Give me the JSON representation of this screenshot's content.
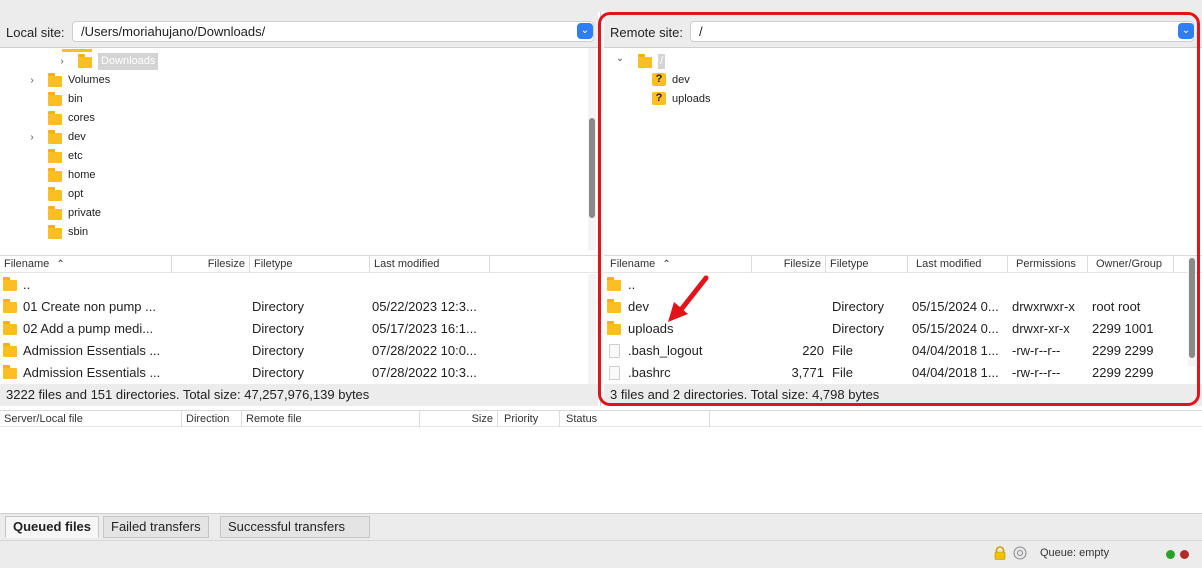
{
  "local": {
    "site_label": "Local site:",
    "site_path": "/Users/moriahujano/Downloads/",
    "tree": [
      {
        "label": "Downloads",
        "chevron": "›",
        "selected": true
      },
      {
        "label": "Volumes",
        "chevron": "›"
      },
      {
        "label": "bin",
        "chevron": ""
      },
      {
        "label": "cores",
        "chevron": ""
      },
      {
        "label": "dev",
        "chevron": "›"
      },
      {
        "label": "etc",
        "chevron": ""
      },
      {
        "label": "home",
        "chevron": ""
      },
      {
        "label": "opt",
        "chevron": ""
      },
      {
        "label": "private",
        "chevron": ""
      },
      {
        "label": "sbin",
        "chevron": ""
      }
    ],
    "columns": {
      "filename": "Filename",
      "filesize": "Filesize",
      "filetype": "Filetype",
      "last_modified": "Last modified"
    },
    "files": [
      {
        "name": "..",
        "size": "",
        "type": "",
        "modified": ""
      },
      {
        "name": "01 Create  non pump ...",
        "size": "",
        "type": "Directory",
        "modified": "05/22/2023 12:3..."
      },
      {
        "name": "02 Add a pump medi...",
        "size": "",
        "type": "Directory",
        "modified": "05/17/2023 16:1..."
      },
      {
        "name": "Admission Essentials ...",
        "size": "",
        "type": "Directory",
        "modified": "07/28/2022 10:0..."
      },
      {
        "name": "Admission Essentials ...",
        "size": "",
        "type": "Directory",
        "modified": "07/28/2022 10:3..."
      }
    ],
    "status": "3222 files and 151 directories. Total size: 47,257,976,139 bytes"
  },
  "remote": {
    "site_label": "Remote site:",
    "site_path": "/",
    "tree": [
      {
        "label": "/",
        "chevron": "⌄",
        "type": "folder",
        "selected": true
      },
      {
        "label": "dev",
        "chevron": "",
        "type": "unknown"
      },
      {
        "label": "uploads",
        "chevron": "",
        "type": "unknown"
      }
    ],
    "columns": {
      "filename": "Filename",
      "filesize": "Filesize",
      "filetype": "Filetype",
      "last_modified": "Last modified",
      "permissions": "Permissions",
      "owner_group": "Owner/Group"
    },
    "files": [
      {
        "name": "..",
        "icon": "folder",
        "size": "",
        "type": "",
        "modified": "",
        "perms": "",
        "owner": ""
      },
      {
        "name": "dev",
        "icon": "folder",
        "size": "",
        "type": "Directory",
        "modified": "05/15/2024 0...",
        "perms": "drwxrwxr-x",
        "owner": "root root"
      },
      {
        "name": "uploads",
        "icon": "folder",
        "size": "",
        "type": "Directory",
        "modified": "05/15/2024 0...",
        "perms": "drwxr-xr-x",
        "owner": "2299 1001"
      },
      {
        "name": ".bash_logout",
        "icon": "file",
        "size": "220",
        "type": "File",
        "modified": "04/04/2018 1...",
        "perms": "-rw-r--r--",
        "owner": "2299 2299"
      },
      {
        "name": ".bashrc",
        "icon": "file",
        "size": "3,771",
        "type": "File",
        "modified": "04/04/2018 1...",
        "perms": "-rw-r--r--",
        "owner": "2299 2299"
      }
    ],
    "status": "3 files and 2 directories. Total size: 4,798 bytes"
  },
  "queue": {
    "columns": {
      "server_local": "Server/Local file",
      "direction": "Direction",
      "remote_file": "Remote file",
      "size": "Size",
      "priority": "Priority",
      "status": "Status"
    }
  },
  "tabs": [
    "Queued files",
    "Failed transfers",
    "Successful transfers"
  ],
  "statusbar": {
    "queue": "Queue: empty"
  },
  "annotation": {
    "highlight_color": "#e3131b",
    "arrow_color": "#e3131b"
  },
  "icons": {
    "folder": "folder-icon",
    "unknown": "question-folder-icon",
    "file": "file-icon",
    "lock": "lock-icon",
    "dropdown": "chevron-down-icon"
  }
}
